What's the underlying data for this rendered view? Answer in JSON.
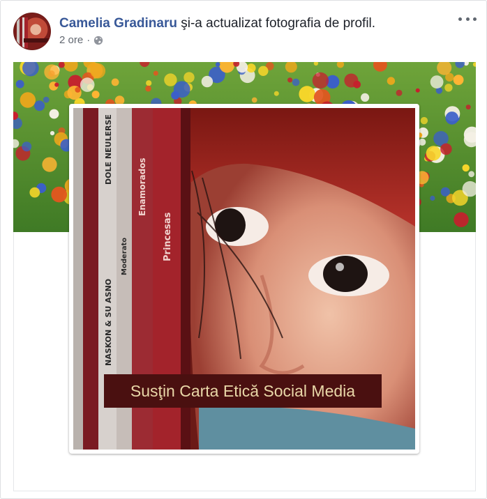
{
  "post": {
    "author_name": "Camelia Gradinaru",
    "action_text": " şi-a actualizat fotografia de profil.",
    "timestamp": "2 ore",
    "separator": "·",
    "privacy_icon": "globe-icon",
    "more_icon": "more-options-icon"
  },
  "photo": {
    "caption": "Susţin Carta Etică Social Media",
    "book_spines": [
      "Princesas",
      "Enamorados",
      "DOLE NEULERSE",
      "NASKON & SU ASNO",
      "Moderato"
    ]
  },
  "colors": {
    "link": "#385898",
    "meta": "#616770",
    "banner": "#4a1010",
    "banner_text": "#e9d7a8"
  }
}
